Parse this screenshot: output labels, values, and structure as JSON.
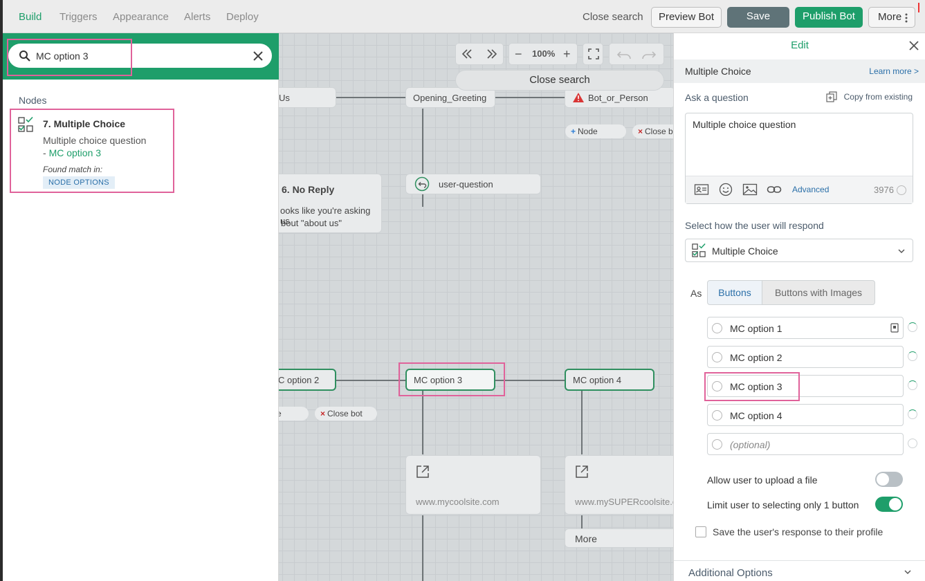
{
  "topbar": {
    "tabs": [
      {
        "label": "Build",
        "active": true
      },
      {
        "label": "Triggers",
        "active": false
      },
      {
        "label": "Appearance",
        "active": false
      },
      {
        "label": "Alerts",
        "active": false
      },
      {
        "label": "Deploy",
        "active": false
      }
    ],
    "close_search": "Close search",
    "preview_bot": "Preview Bot",
    "save": "Save",
    "publish_bot": "Publish Bot",
    "more": "More"
  },
  "search": {
    "value": "MC option 3",
    "section_label": "Nodes",
    "result": {
      "title": "7. Multiple Choice",
      "description": "Multiple choice question",
      "dash": "- ",
      "matched_option": "MC option 3",
      "found_label": "Found match in:",
      "tag": "NODE OPTIONS"
    }
  },
  "canvas": {
    "zoom": "100%",
    "close_search": "Close search",
    "nodes": {
      "about_us": "Us",
      "opening_greeting": "Opening_Greeting",
      "bot_or_person": "Bot_or_Person",
      "user_question": "user-question",
      "no_reply_title": "6. No Reply",
      "no_reply_line1": "ooks like you're asking us",
      "no_reply_line2": "bout \"about us\"",
      "mc2": "C option 2",
      "mc3": "MC option 3",
      "mc4": "MC option 4",
      "link1": "www.mycoolsite.com",
      "link2": "www.mySUPERcoolsite.co",
      "more": "More"
    },
    "pills": {
      "node": "Node",
      "close_b_top": "Close b",
      "e_partial": "e",
      "close_bot": "Close bot"
    }
  },
  "edit": {
    "title": "Edit",
    "node_name": "Multiple Choice",
    "learn_more": "Learn more >",
    "ask_label": "Ask a question",
    "copy_existing": "Copy from existing",
    "question_text": "Multiple choice question",
    "advanced": "Advanced",
    "char_count": "3976",
    "respond_label": "Select how the user will respond",
    "respond_value": "Multiple Choice",
    "as_label": "As",
    "seg_buttons": "Buttons",
    "seg_images": "Buttons with Images",
    "options": [
      "MC option 1",
      "MC option 2",
      "MC option 3",
      "MC option 4"
    ],
    "optional_placeholder": "(optional)",
    "allow_upload": "Allow user to upload a file",
    "allow_upload_on": false,
    "limit_one": "Limit user to selecting only 1 button",
    "limit_one_on": true,
    "save_response": "Save the user's response to their profile",
    "additional_options": "Additional Options"
  },
  "colors": {
    "brand_green": "#1e9e6a",
    "highlight_pink": "#e0629a",
    "link_blue": "#2a6fa8",
    "warning_red": "#c62828"
  },
  "icons": [
    "search-icon",
    "clear-icon",
    "multiple-choice-icon",
    "close-icon",
    "copy-icon",
    "contact-card-icon",
    "emoji-icon",
    "image-icon",
    "link-icon",
    "chevron-down-icon",
    "warning-icon",
    "external-link-icon",
    "undo-icon",
    "redo-icon",
    "fullscreen-icon",
    "phone-icon"
  ]
}
